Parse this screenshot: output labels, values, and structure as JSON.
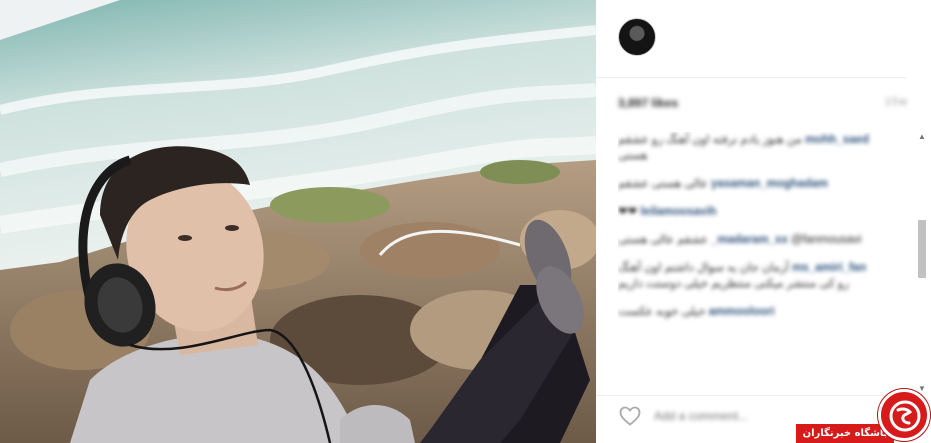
{
  "post": {
    "likes": "3,897 likes",
    "time_ago": "15w"
  },
  "comments": [
    {
      "user": "mohh_saed",
      "text": "من هنوز یادم نرفته اون آهنگ رو عشقم هستی"
    },
    {
      "user": "yasaman_moghadam",
      "text": "عالی هستی عشقم"
    },
    {
      "user": "leilamoosavih",
      "text": "❤❤"
    },
    {
      "user": "_madaram_xx",
      "text": "@fanmousavi عشقم عالی هستی"
    },
    {
      "user": "ms_amiri_fan",
      "text": "آرمان جان یه سوال داشتم اون آهنگ رو کی منتشر میکنی منتظریم خیلی دوستت داریم"
    },
    {
      "user": "ammooloori",
      "text": "خیلی خوبه عکست"
    }
  ],
  "footer": {
    "add_comment_placeholder": "Add a comment..."
  },
  "watermark": {
    "label": "باشگاه خبرنگاران"
  },
  "colors": {
    "username": "#2b4f7a",
    "badge": "#d71a1a"
  },
  "icons": {
    "like": "heart-outline-icon",
    "badge": "globe-icon",
    "scroll_up": "arrow-up-icon",
    "scroll_down": "arrow-down-icon"
  }
}
